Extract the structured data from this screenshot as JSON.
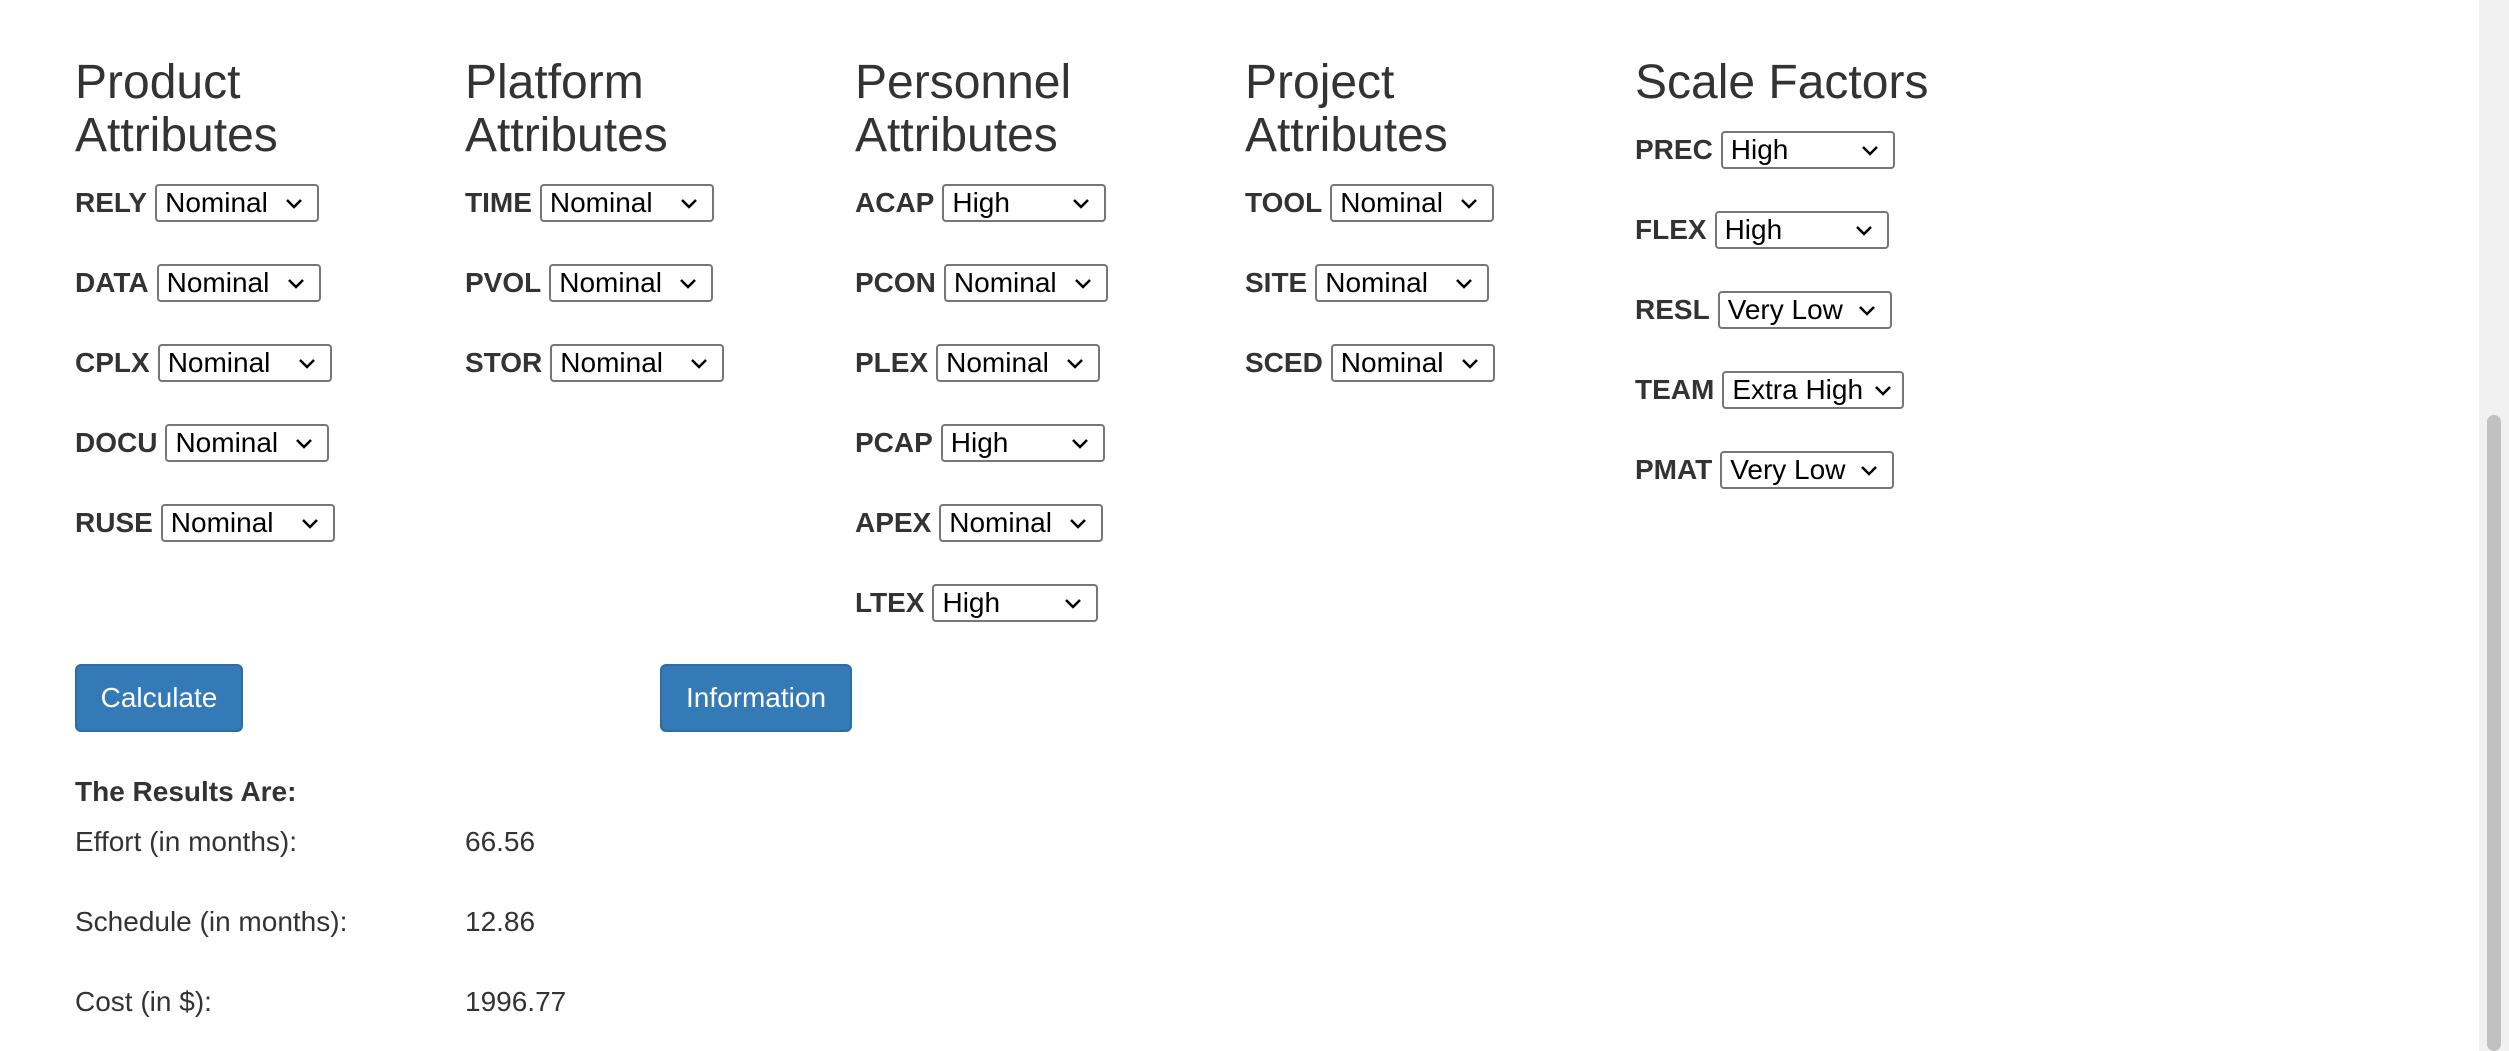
{
  "product": {
    "heading": "Product Attributes",
    "fields": [
      {
        "label": "RELY",
        "value": "Nominal"
      },
      {
        "label": "DATA",
        "value": "Nominal"
      },
      {
        "label": "CPLX",
        "value": "Nominal"
      },
      {
        "label": "DOCU",
        "value": "Nominal"
      },
      {
        "label": "RUSE",
        "value": "Nominal"
      }
    ]
  },
  "platform": {
    "heading": "Platform Attributes",
    "fields": [
      {
        "label": "TIME",
        "value": "Nominal"
      },
      {
        "label": "PVOL",
        "value": "Nominal"
      },
      {
        "label": "STOR",
        "value": "Nominal"
      }
    ]
  },
  "personnel": {
    "heading": "Personnel Attributes",
    "fields": [
      {
        "label": "ACAP",
        "value": "High"
      },
      {
        "label": "PCON",
        "value": "Nominal"
      },
      {
        "label": "PLEX",
        "value": "Nominal"
      },
      {
        "label": "PCAP",
        "value": "High"
      },
      {
        "label": "APEX",
        "value": "Nominal"
      },
      {
        "label": "LTEX",
        "value": "High"
      }
    ]
  },
  "project": {
    "heading": "Project Attributes",
    "fields": [
      {
        "label": "TOOL",
        "value": "Nominal"
      },
      {
        "label": "SITE",
        "value": "Nominal"
      },
      {
        "label": "SCED",
        "value": "Nominal"
      }
    ]
  },
  "scale": {
    "heading": "Scale Factors",
    "fields": [
      {
        "label": "PREC",
        "value": "High"
      },
      {
        "label": "FLEX",
        "value": "High"
      },
      {
        "label": "RESL",
        "value": "Very Low"
      },
      {
        "label": "TEAM",
        "value": "Extra High"
      },
      {
        "label": "PMAT",
        "value": "Very Low"
      }
    ]
  },
  "buttons": {
    "calculate": "Calculate",
    "information": "Information"
  },
  "results": {
    "heading": "The Results Are:",
    "effort_label": "Effort (in months):",
    "effort_value": "66.56",
    "schedule_label": "Schedule (in months):",
    "schedule_value": "12.86",
    "cost_label": "Cost (in $):",
    "cost_value": "1996.77"
  }
}
